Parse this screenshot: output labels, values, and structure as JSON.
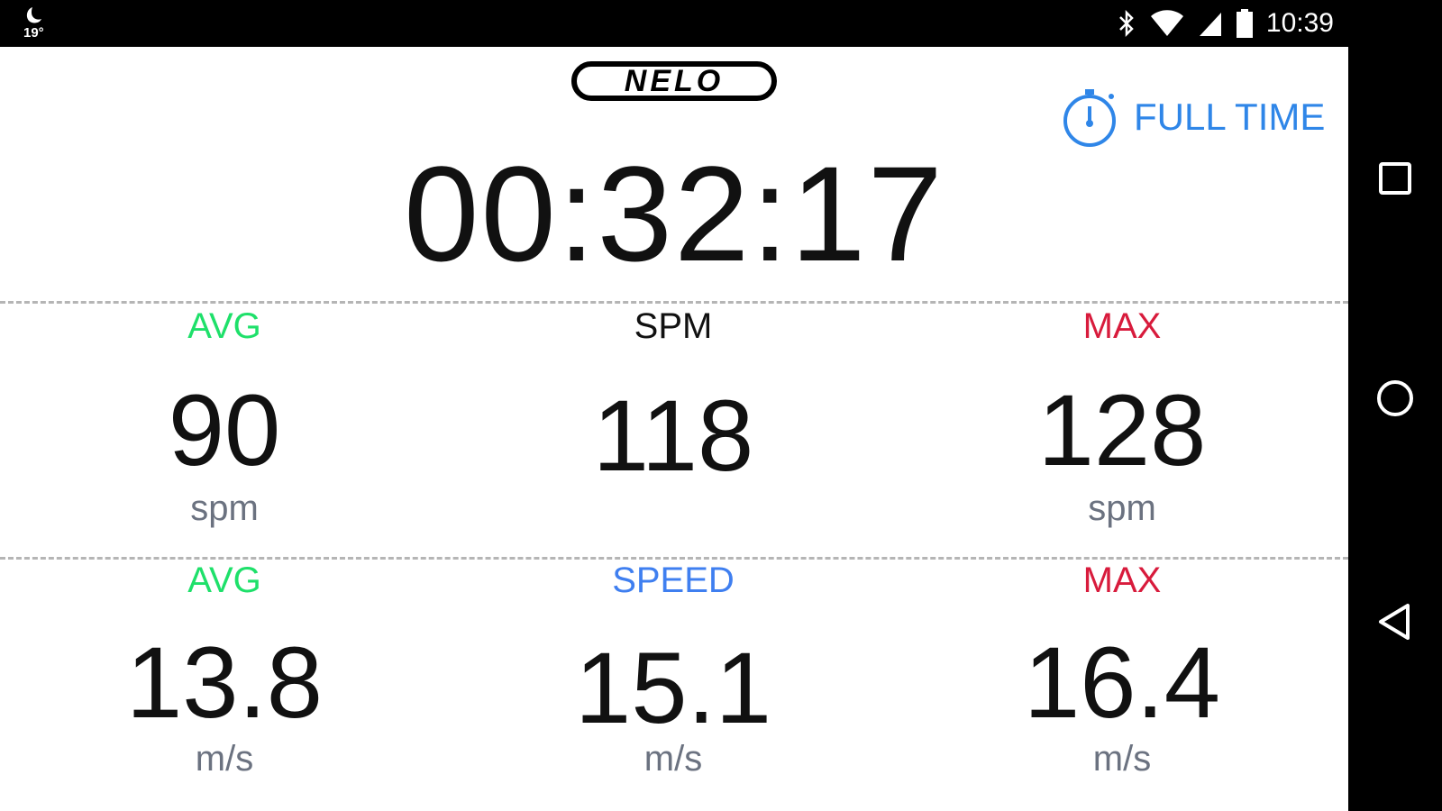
{
  "status_bar": {
    "weather_temp": "19°",
    "time": "10:39",
    "icons": [
      "bluetooth-icon",
      "wifi-icon",
      "cell-signal-icon",
      "battery-icon"
    ]
  },
  "app": {
    "logo_text": "NELO",
    "mode": {
      "icon": "stopwatch-icon",
      "label": "FULL TIME"
    },
    "timer": "00:32:17",
    "stroke_rate": {
      "avg_label": "AVG",
      "avg_value": "90",
      "avg_unit": "spm",
      "current_label": "SPM",
      "current_value": "118",
      "max_label": "MAX",
      "max_value": "128",
      "max_unit": "spm"
    },
    "speed": {
      "avg_label": "AVG",
      "avg_value": "13.8",
      "avg_unit": "m/s",
      "current_label": "SPEED",
      "current_value": "15.1",
      "current_unit": "m/s",
      "max_label": "MAX",
      "max_value": "16.4",
      "max_unit": "m/s"
    }
  },
  "colors": {
    "avg": "#1ee06a",
    "max": "#d81b3c",
    "speed": "#3f7ff0",
    "full_time": "#2f86e8"
  },
  "navigation": [
    "recents-square-icon",
    "home-circle-icon",
    "back-triangle-icon"
  ]
}
